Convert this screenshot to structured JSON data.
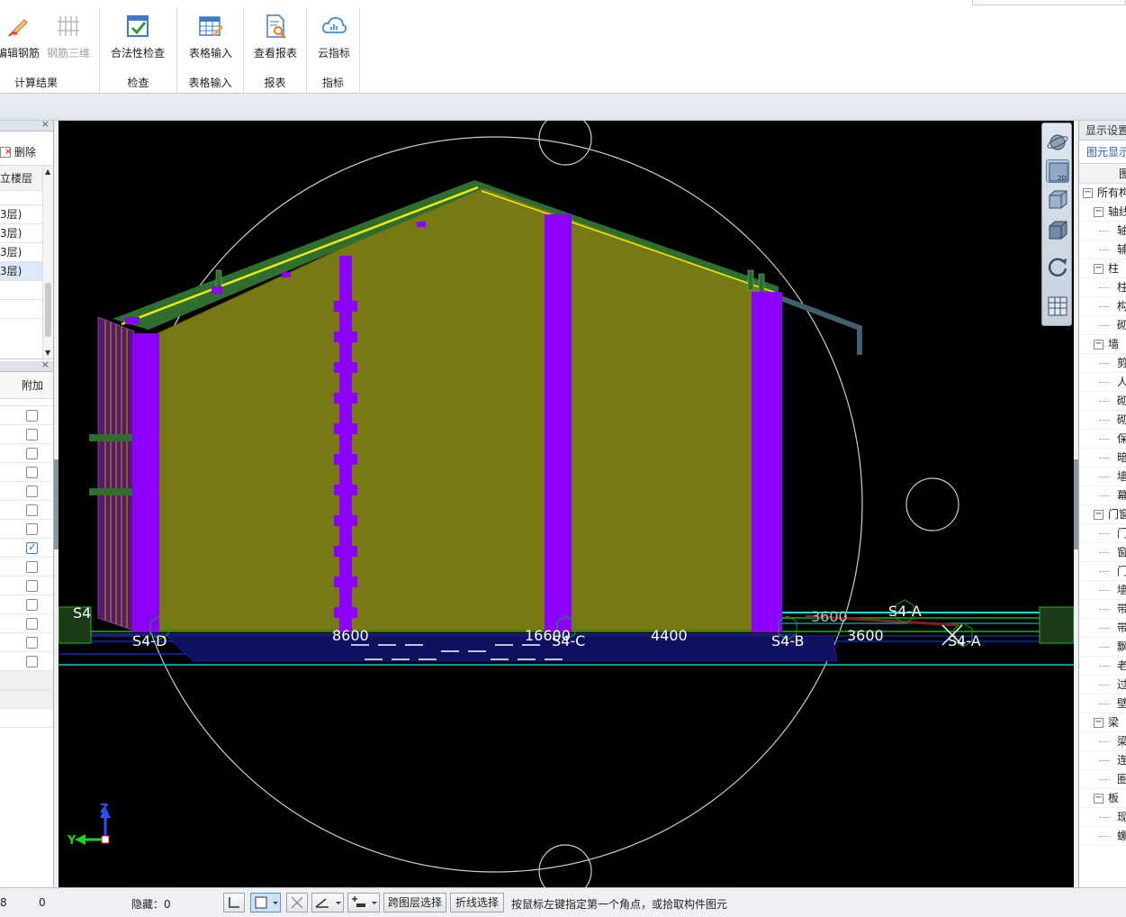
{
  "ribbon": {
    "groups": [
      {
        "label": "计算结果",
        "buttons": [
          {
            "label": "编辑钢筋",
            "enabled": true
          },
          {
            "label": "钢筋三维",
            "enabled": false
          }
        ]
      },
      {
        "label": "检查",
        "buttons": [
          {
            "label": "合法性检查",
            "enabled": true
          }
        ]
      },
      {
        "label": "表格输入",
        "buttons": [
          {
            "label": "表格输入",
            "enabled": true
          }
        ]
      },
      {
        "label": "报表",
        "buttons": [
          {
            "label": "查看报表",
            "enabled": true
          }
        ]
      },
      {
        "label": "指标",
        "buttons": [
          {
            "label": "云指标",
            "enabled": true
          }
        ]
      }
    ]
  },
  "left_panel": {
    "close_glyph": "×",
    "delete_label": "删除",
    "floor_header": "立楼层",
    "floors": [
      "3层)",
      "3层)",
      "3层)",
      "3层)"
    ],
    "selected_floor_index": 3,
    "attr_header": "附加",
    "attr_checks": [
      false,
      false,
      false,
      false,
      false,
      false,
      false,
      true,
      false,
      false,
      false,
      false,
      false,
      false
    ]
  },
  "viewport": {
    "axis_labels": [
      {
        "text": "S4-D"
      },
      {
        "text": "S4-C"
      },
      {
        "text": "S4-B"
      },
      {
        "text": "S4-A"
      },
      {
        "text": "S4-A"
      },
      {
        "text": "S4"
      }
    ],
    "dimensions": [
      "8600",
      "16600",
      "4400",
      "3600",
      "3600"
    ],
    "axis_triad": {
      "z": "Z",
      "y": "Y"
    },
    "colors": {
      "background": "#000000",
      "wall": "#787814",
      "column": "#8c00ff",
      "roof": "#2f6e2f",
      "trim": "#f0f000"
    }
  },
  "nav_toolbar": {
    "buttons": [
      "orbit-icon",
      "view-2d-icon",
      "view-3d-box-icon",
      "view-solid-icon",
      "rotate-icon",
      "grid-display-icon"
    ],
    "label_2d": "2D"
  },
  "right_panel": {
    "title": "显示设置",
    "tab": "图元显示",
    "column_header": "图",
    "tree": [
      {
        "level": 0,
        "toggle": "−",
        "text": "所有构"
      },
      {
        "level": 1,
        "toggle": "−",
        "text": "轴线"
      },
      {
        "level": 2,
        "text": "轴"
      },
      {
        "level": 2,
        "text": "辅"
      },
      {
        "level": 1,
        "toggle": "−",
        "text": "柱"
      },
      {
        "level": 2,
        "text": "柱"
      },
      {
        "level": 2,
        "text": "构"
      },
      {
        "level": 2,
        "text": "砌"
      },
      {
        "level": 1,
        "toggle": "−",
        "text": "墙"
      },
      {
        "level": 2,
        "text": "剪"
      },
      {
        "level": 2,
        "text": "人"
      },
      {
        "level": 2,
        "text": "砌"
      },
      {
        "level": 2,
        "text": "砌"
      },
      {
        "level": 2,
        "text": "保"
      },
      {
        "level": 2,
        "text": "暗"
      },
      {
        "level": 2,
        "text": "墙"
      },
      {
        "level": 2,
        "text": "幕"
      },
      {
        "level": 1,
        "toggle": "−",
        "text": "门窗"
      },
      {
        "level": 2,
        "text": "门"
      },
      {
        "level": 2,
        "text": "窗"
      },
      {
        "level": 2,
        "text": "门"
      },
      {
        "level": 2,
        "text": "墙"
      },
      {
        "level": 2,
        "text": "带"
      },
      {
        "level": 2,
        "text": "带"
      },
      {
        "level": 2,
        "text": "飘"
      },
      {
        "level": 2,
        "text": "老"
      },
      {
        "level": 2,
        "text": "过"
      },
      {
        "level": 2,
        "text": "壁"
      },
      {
        "level": 1,
        "toggle": "−",
        "text": "梁"
      },
      {
        "level": 2,
        "text": "梁"
      },
      {
        "level": 2,
        "text": "连"
      },
      {
        "level": 2,
        "text": "圈"
      },
      {
        "level": 1,
        "toggle": "−",
        "text": "板"
      },
      {
        "level": 2,
        "text": "现"
      },
      {
        "level": 2,
        "text": "螺"
      }
    ]
  },
  "status_bar": {
    "left_value_1": "8",
    "left_value_2": "0",
    "hidden_label": "隐藏：0",
    "btn_cross_layer": "跨图层选择",
    "btn_polyline": "折线选择",
    "hint": "按鼠标左键指定第一个角点，或拾取构件图元"
  }
}
